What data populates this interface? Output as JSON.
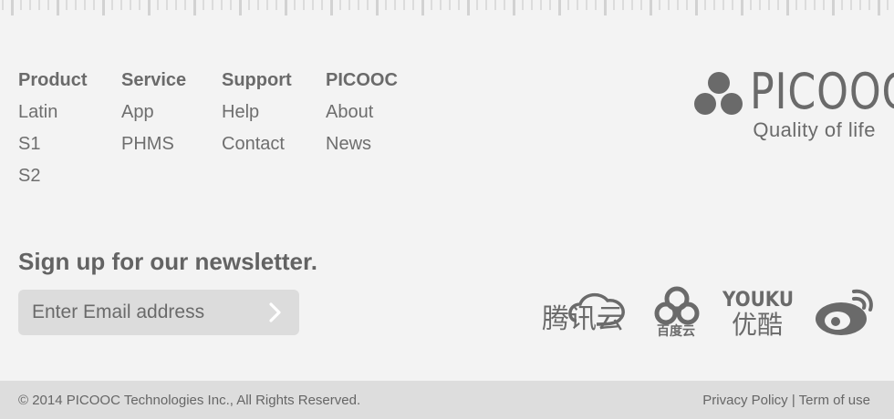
{
  "nav": {
    "columns": [
      {
        "heading": "Product",
        "items": [
          "Latin",
          "S1",
          "S2"
        ]
      },
      {
        "heading": "Service",
        "items": [
          "App",
          "PHMS"
        ]
      },
      {
        "heading": "Support",
        "items": [
          "Help",
          "Contact"
        ]
      },
      {
        "heading": "PICOOC",
        "items": [
          "About",
          "News"
        ]
      }
    ]
  },
  "brand": {
    "name": "PICOOC",
    "tagline": "Quality of life"
  },
  "newsletter": {
    "title": "Sign up for our newsletter.",
    "placeholder": "Enter Email address",
    "submit_icon": "chevron-right-icon"
  },
  "social": {
    "tencent_cloud": {
      "label": "腾讯云",
      "icon": "tencent-cloud-icon"
    },
    "baidu_cloud": {
      "label": "百度云",
      "icon": "baidu-cloud-icon"
    },
    "youku": {
      "label_top": "YOUKU",
      "label_bottom": "优酷",
      "icon": "youku-icon"
    },
    "weibo": {
      "icon": "weibo-icon"
    }
  },
  "footer": {
    "copyright": "© 2014 PICOOC Technologies Inc., All Rights Reserved.",
    "privacy": "Privacy Policy",
    "separator": " | ",
    "terms": "Term of use"
  },
  "colors": {
    "background": "#f3f3f3",
    "text": "#6a6a6a",
    "input_bg": "#dcdcdc",
    "footer_bg": "#dddddd"
  }
}
